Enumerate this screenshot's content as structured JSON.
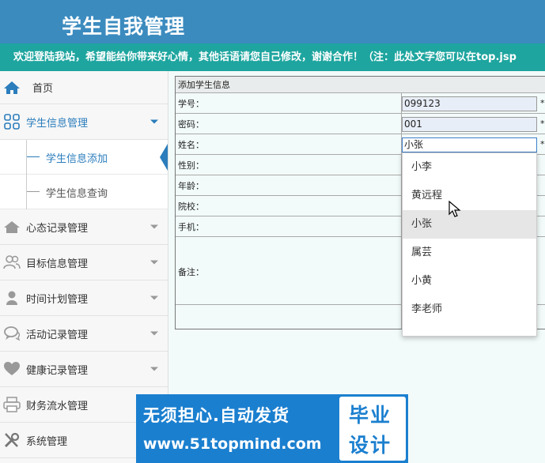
{
  "header": {
    "title": "学生自我管理"
  },
  "marquee": {
    "text": "欢迎登陆我站，希望能给你带来好心情，其他话语请您自己修改，谢谢合作！（注：此处文字您可以在top.jsp"
  },
  "sidebar": {
    "home": "首页",
    "student_mgmt": "学生信息管理",
    "sub_items": [
      "学生信息添加",
      "学生信息查询"
    ],
    "items": [
      "心态记录管理",
      "目标信息管理",
      "时间计划管理",
      "活动记录管理",
      "健康记录管理",
      "财务流水管理",
      "系统管理"
    ]
  },
  "form": {
    "title": "添加学生信息",
    "fields": {
      "student_no": {
        "label": "学号：",
        "value": "099123"
      },
      "password": {
        "label": "密码：",
        "value": "001"
      },
      "name": {
        "label": "姓名：",
        "value": "小张"
      },
      "gender": {
        "label": "性别："
      },
      "age": {
        "label": "年龄："
      },
      "college": {
        "label": "院校："
      },
      "phone": {
        "label": "手机："
      },
      "remark": {
        "label": "备注："
      }
    },
    "required_mark": "*"
  },
  "autocomplete": {
    "options": [
      "小李",
      "黄远程",
      "小张",
      "属芸",
      "小黄",
      "李老师"
    ]
  },
  "ad": {
    "line1": "无须担心.自动发货",
    "line2": "www.51topmind.com",
    "badge_line1": "毕业",
    "badge_line2": "设计"
  },
  "colors": {
    "header": "#3b8bbf",
    "marquee": "#1ea59f",
    "accent": "#2b7dbc",
    "ad": "#1b7fcf"
  }
}
